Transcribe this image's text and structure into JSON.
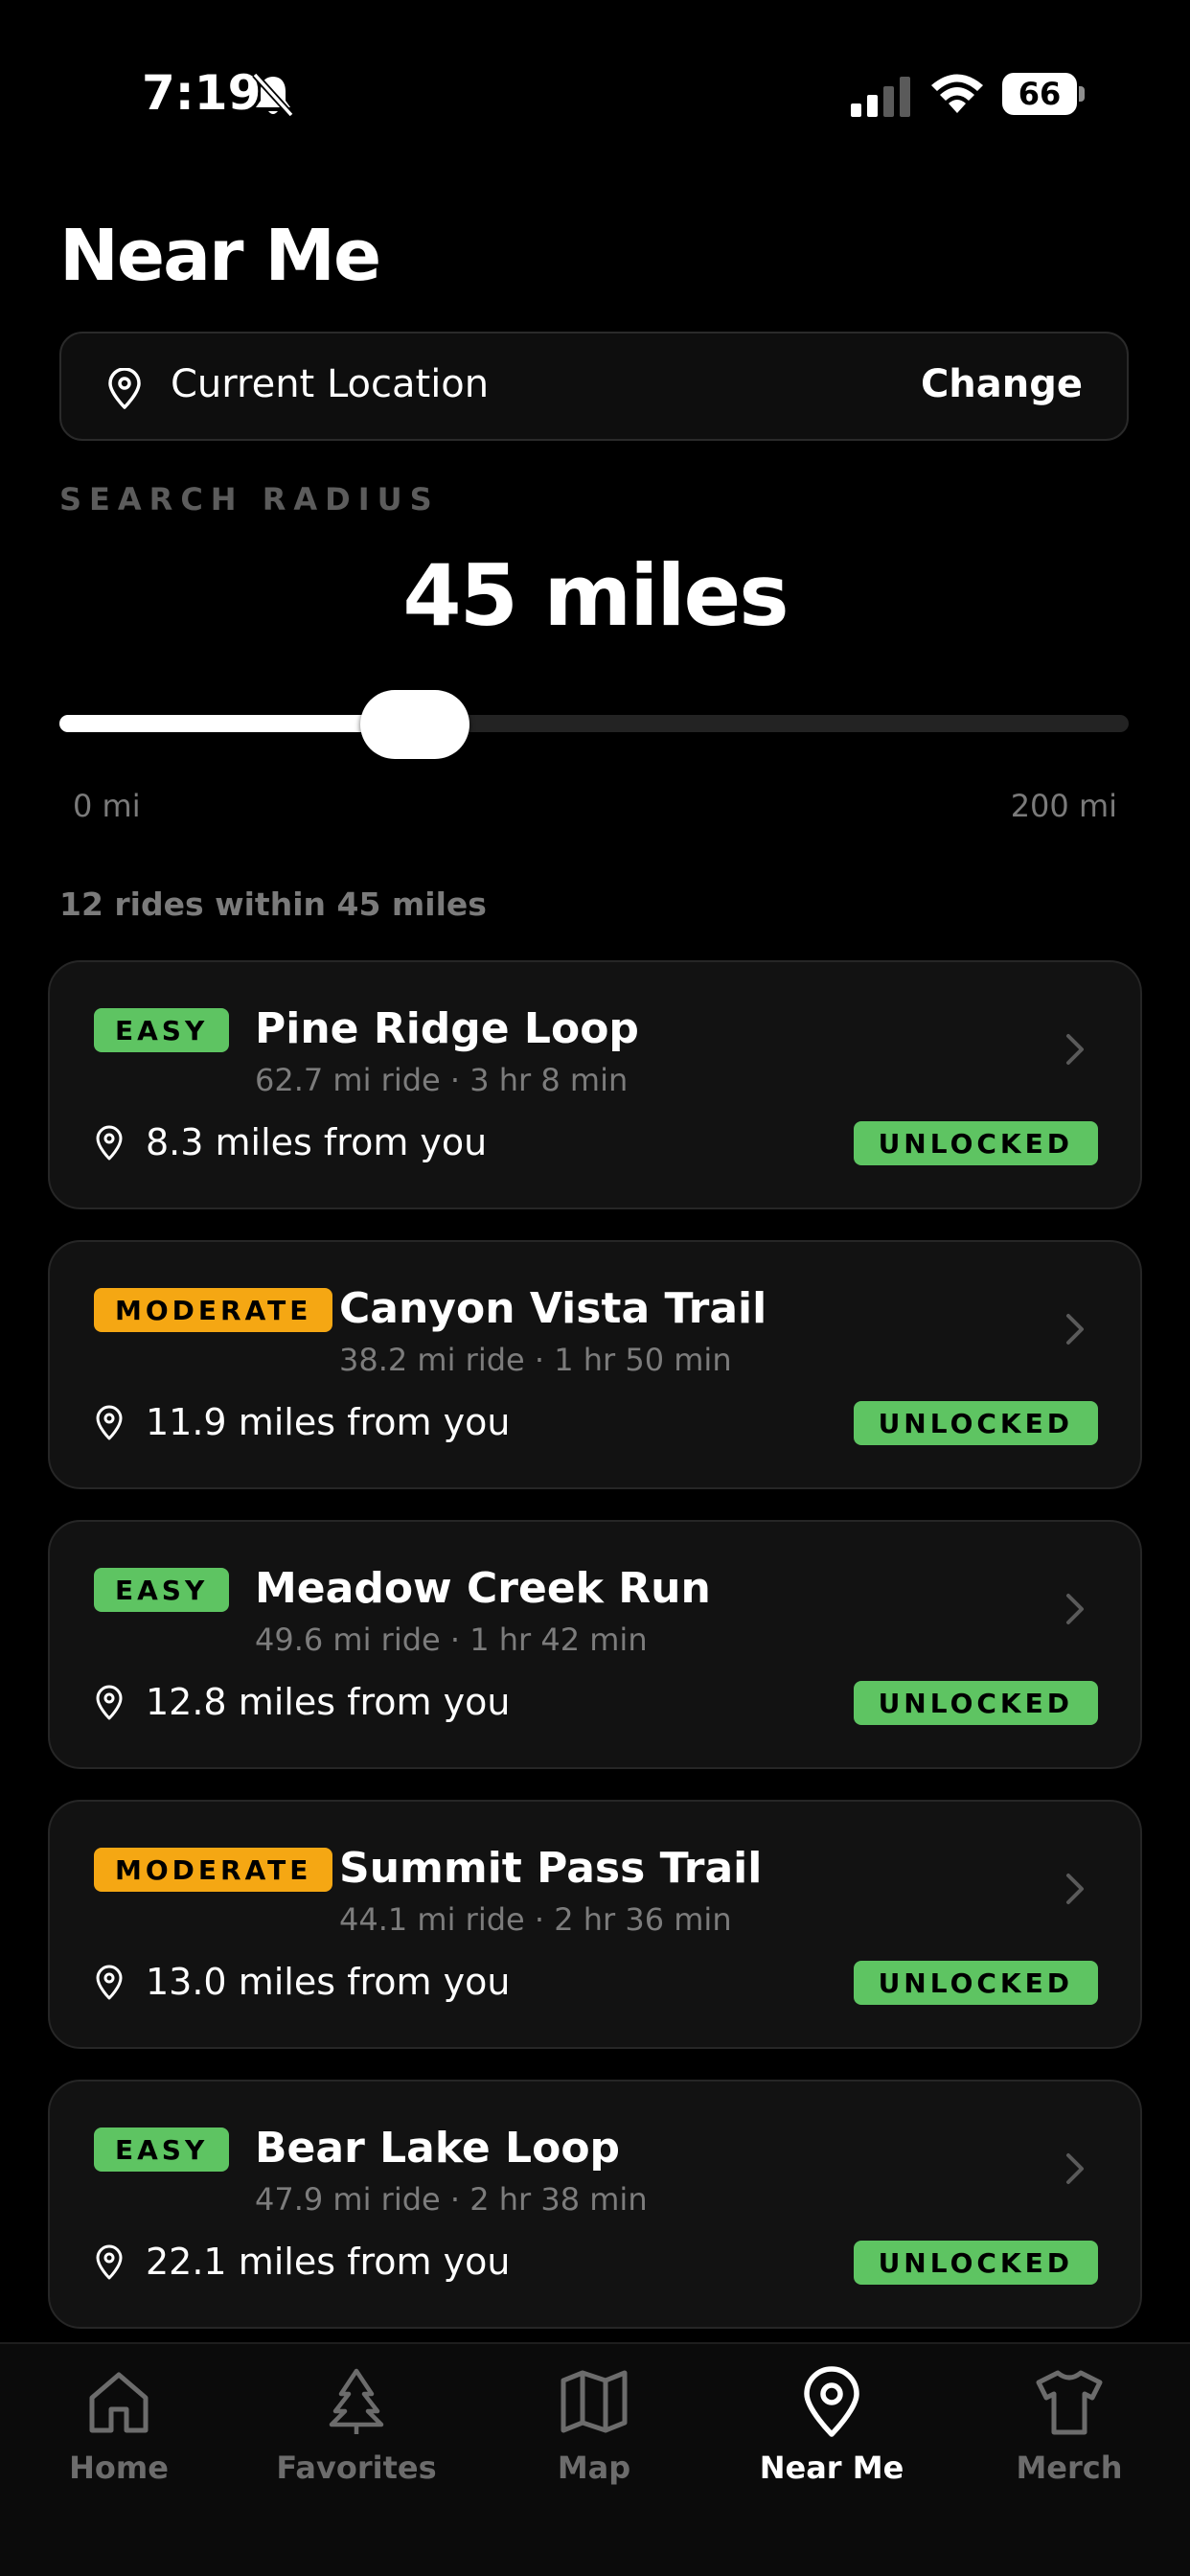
{
  "status_bar": {
    "time": "7:19",
    "battery": "66"
  },
  "page": {
    "title": "Near Me"
  },
  "location": {
    "label": "Current Location",
    "action": "Change"
  },
  "radius": {
    "label": "SEARCH RADIUS",
    "value_text": "45 miles",
    "value": 45,
    "min_label": "0 mi",
    "max_label": "200 mi",
    "min": 0,
    "max": 200
  },
  "results": {
    "count_text": "12 rides within 45 miles"
  },
  "rides": [
    {
      "difficulty": "EASY",
      "name": "Pine Ridge Loop",
      "meta": "62.7 mi ride · 3 hr 8 min",
      "distance": "8.3 miles from you",
      "status": "UNLOCKED"
    },
    {
      "difficulty": "MODERATE",
      "name": "Canyon Vista Trail",
      "meta": "38.2 mi ride · 1 hr 50 min",
      "distance": "11.9 miles from you",
      "status": "UNLOCKED"
    },
    {
      "difficulty": "EASY",
      "name": "Meadow Creek Run",
      "meta": "49.6 mi ride · 1 hr 42 min",
      "distance": "12.8 miles from you",
      "status": "UNLOCKED"
    },
    {
      "difficulty": "MODERATE",
      "name": "Summit Pass Trail",
      "meta": "44.1 mi ride · 2 hr 36 min",
      "distance": "13.0 miles from you",
      "status": "UNLOCKED"
    },
    {
      "difficulty": "EASY",
      "name": "Bear Lake Loop",
      "meta": "47.9 mi ride · 2 hr 38 min",
      "distance": "22.1 miles from you",
      "status": "UNLOCKED"
    }
  ],
  "tabs": [
    {
      "label": "Home",
      "icon": "home-icon",
      "active": false
    },
    {
      "label": "Favorites",
      "icon": "tree-icon",
      "active": false
    },
    {
      "label": "Map",
      "icon": "map-icon",
      "active": false
    },
    {
      "label": "Near Me",
      "icon": "location-pin-icon",
      "active": true
    },
    {
      "label": "Merch",
      "icon": "shirt-icon",
      "active": false
    }
  ],
  "colors": {
    "easy": "#5ec462",
    "moderate": "#f5a713",
    "unlocked": "#5ec462",
    "background": "#000000"
  }
}
